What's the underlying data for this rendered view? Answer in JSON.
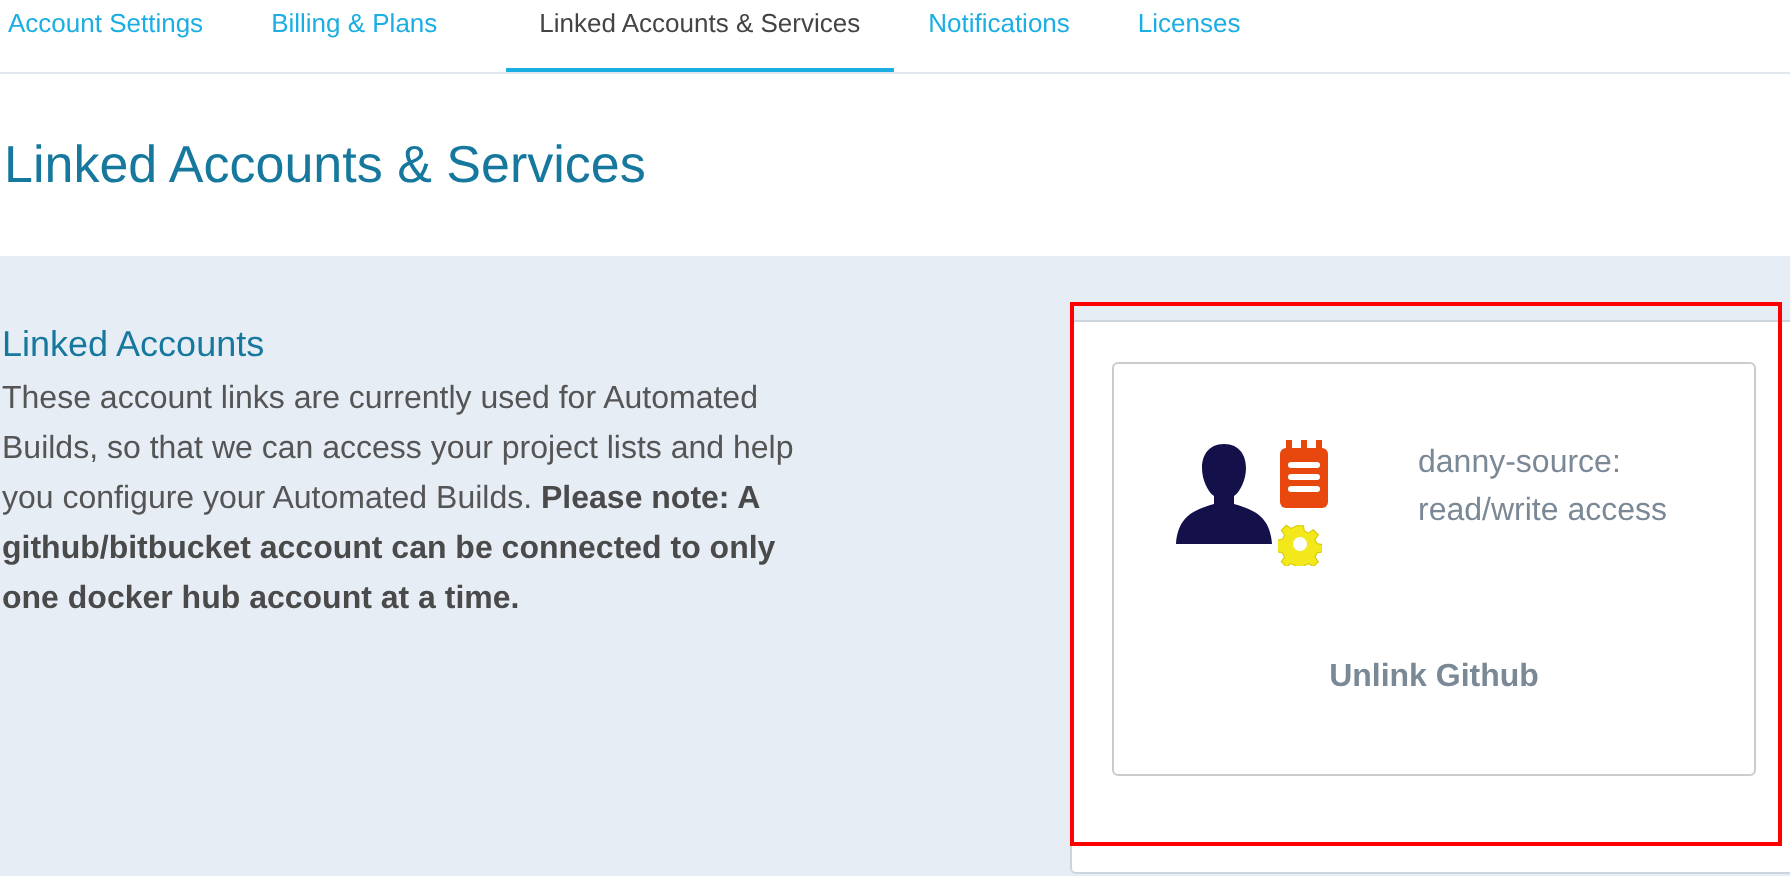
{
  "tabs": [
    {
      "label": "Account Settings",
      "selected": false
    },
    {
      "label": "Billing & Plans",
      "selected": false
    },
    {
      "label": "Linked Accounts & Services",
      "selected": true
    },
    {
      "label": "Notifications",
      "selected": false
    },
    {
      "label": "Licenses",
      "selected": false
    }
  ],
  "page_title": "Linked Accounts & Services",
  "section": {
    "heading": "Linked Accounts",
    "description": "These account links are currently used for Automated Builds, so that we can access your project lists and help you configure your Automated Builds.  **Please note: A github/bitbucket account can be connected to only one docker hub account at a time.**"
  },
  "linked_account": {
    "account": "danny-source:",
    "access": "read/write access",
    "action": "Unlink Github"
  }
}
